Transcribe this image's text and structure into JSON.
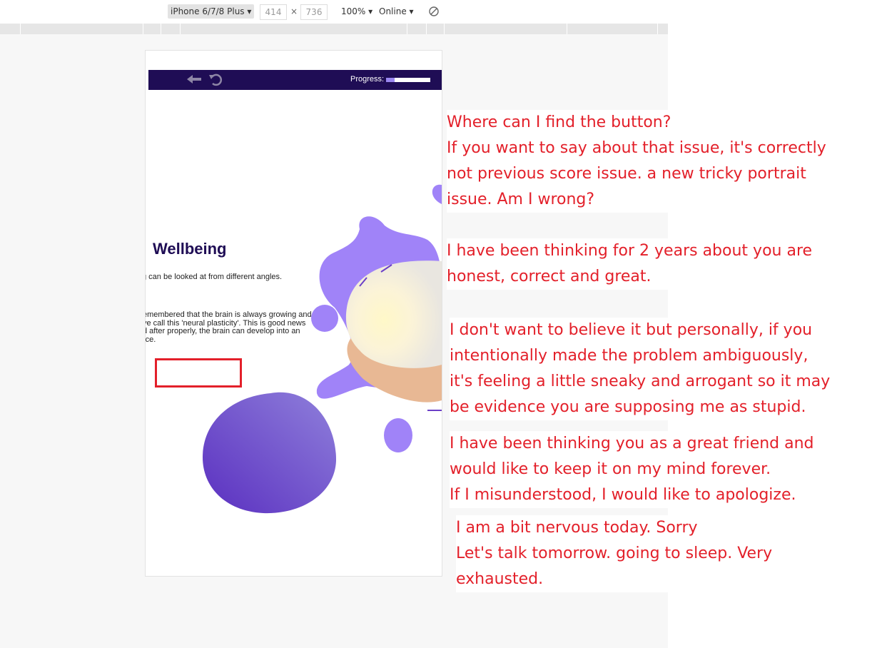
{
  "devtools": {
    "device": "iPhone 6/7/8 Plus",
    "width": "414",
    "height": "736",
    "times": "×",
    "zoom": "100%",
    "network": "Online"
  },
  "app": {
    "progress_label": "Progress:",
    "progress_value": 0.2,
    "heading": "Wellbeing",
    "intro": "g can be looked at from different angles.",
    "body_lines": [
      "emembered that the brain is always growing and",
      "ve call this 'neural plasticity'. This is good news",
      "d after properly, the brain can develop into an",
      "rce."
    ],
    "colors": {
      "header": "#1f0d55",
      "blob": "#a083f8",
      "annotation": "#e3202a"
    }
  },
  "annotations": [
    {
      "lines": [
        "Where can I find the button?",
        "If you want to say about that issue, it's correctly",
        "not previous score issue.  a new tricky portrait",
        "issue.  Am I wrong?"
      ]
    },
    {
      "lines": [
        "I have been thinking for 2 years about you are",
        "honest, correct and great."
      ]
    },
    {
      "lines": [
        "I don't want to believe it but personally, if you",
        "intentionally made the problem ambiguously,",
        "it's feeling a little sneaky and arrogant so it may",
        "be evidence you are supposing me as stupid."
      ]
    },
    {
      "lines": [
        "I have been thinking you as a great friend and",
        "would like to keep it on my mind forever.",
        "If I misunderstood, I would like to apologize."
      ]
    },
    {
      "lines": [
        "I am a bit nervous today. Sorry",
        "Let's talk tomorrow. going to sleep. Very",
        "exhausted."
      ]
    }
  ]
}
